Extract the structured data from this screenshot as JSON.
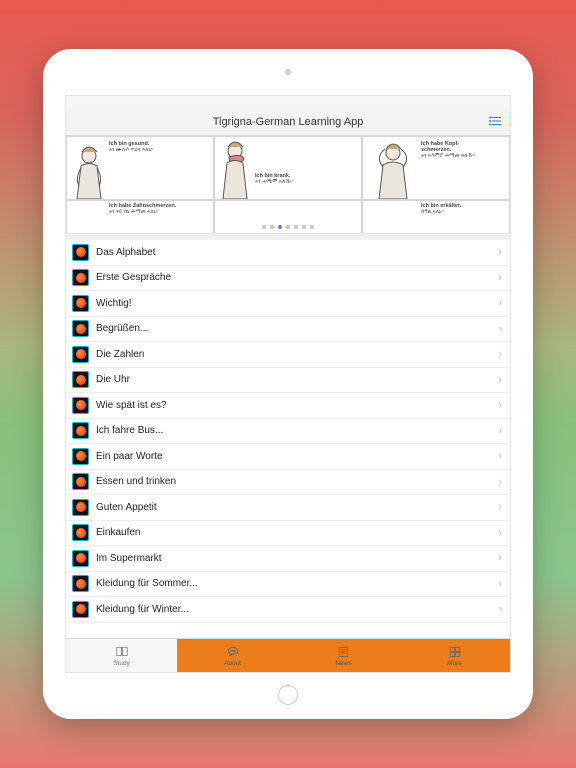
{
  "header": {
    "title": "Tigrigna-German Learning App"
  },
  "carousel": {
    "panels": [
      {
        "de": "Ich bin gesund.",
        "ti": "ኣነ ሙሉእ ጥዕና ኣለኒ።"
      },
      {
        "de": "Ich bin krank.",
        "ti": "ኣነ ሓሚሞ ኣለኹ።"
      },
      {
        "de": "Ich habe Kopf-schmerzen.",
        "ti": "ኣነ ኣእምሮ ሕማመ ኣለኹ።"
      },
      {
        "de": "Ich habe Zahnschmerzen.",
        "ti": "ኣነ ናይ ሰኒ ሕማመ ኣለኒ።"
      },
      {
        "de": "",
        "ti": ""
      },
      {
        "de": "Ich bin erkältet.",
        "ti": "ሰዓል ኣለኒ።"
      }
    ],
    "page_count": 7,
    "active_page": 2
  },
  "lessons": [
    {
      "label": "Das Alphabet"
    },
    {
      "label": "Erste Gespräche"
    },
    {
      "label": "Wichtig!"
    },
    {
      "label": "Begrüßen..."
    },
    {
      "label": "Die Zahlen"
    },
    {
      "label": "Die Uhr"
    },
    {
      "label": "Wie spät ist es?"
    },
    {
      "label": "Ich fahre Bus..."
    },
    {
      "label": "Ein paar Worte"
    },
    {
      "label": "Essen und trinken"
    },
    {
      "label": "Guten Appetit"
    },
    {
      "label": "Einkaufen"
    },
    {
      "label": "Im Supermarkt"
    },
    {
      "label": "Kleidung für Sommer..."
    },
    {
      "label": "Kleidung für Winter..."
    }
  ],
  "tabs": [
    {
      "label": "Study"
    },
    {
      "label": "About"
    },
    {
      "label": "News"
    },
    {
      "label": "More"
    }
  ]
}
